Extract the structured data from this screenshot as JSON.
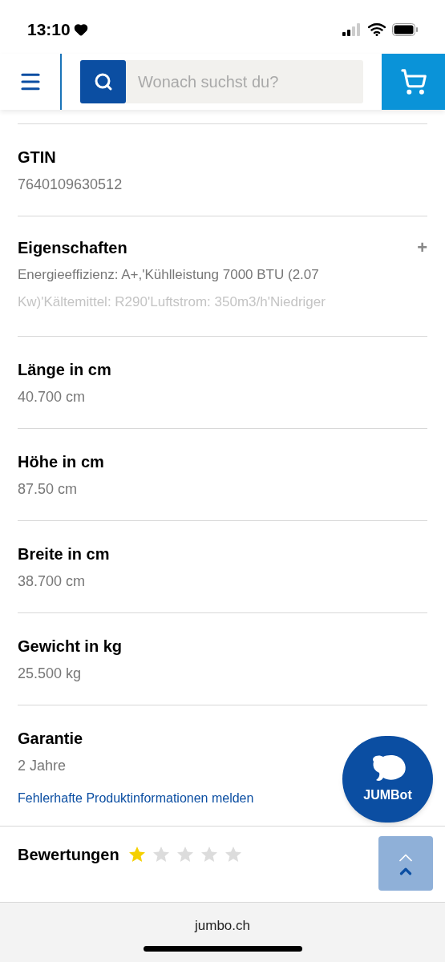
{
  "status_bar": {
    "time": "13:10"
  },
  "header": {
    "search": {
      "placeholder": "Wonach suchst du?"
    }
  },
  "details": [
    {
      "kind": "plain",
      "label": "GTIN",
      "value": "7640109630512"
    },
    {
      "kind": "expandable",
      "label": "Eigenschaften",
      "expanded": false,
      "expand_symbol": "+",
      "lines": [
        "Energieeffizienz: A+,'Kühlleistung 7000 BTU (2.07",
        "Kw)'Kältemittel: R290'Luftstrom: 350m3/h'Niedriger"
      ]
    },
    {
      "kind": "plain",
      "label": "Länge in cm",
      "value": "40.700 cm"
    },
    {
      "kind": "plain",
      "label": "Höhe in cm",
      "value": "87.50 cm"
    },
    {
      "kind": "plain",
      "label": "Breite in cm",
      "value": "38.700 cm"
    },
    {
      "kind": "plain",
      "label": "Gewicht in kg",
      "value": "25.500 kg"
    },
    {
      "kind": "plain",
      "label": "Garantie",
      "value": "2 Jahre"
    }
  ],
  "report_link": "Fehlerhafte Produktinformationen melden",
  "reviews": {
    "label": "Bewertungen",
    "stars": 1
  },
  "chatbot": {
    "label": "JUMBot"
  },
  "browser": {
    "url": "jumbo.ch"
  }
}
